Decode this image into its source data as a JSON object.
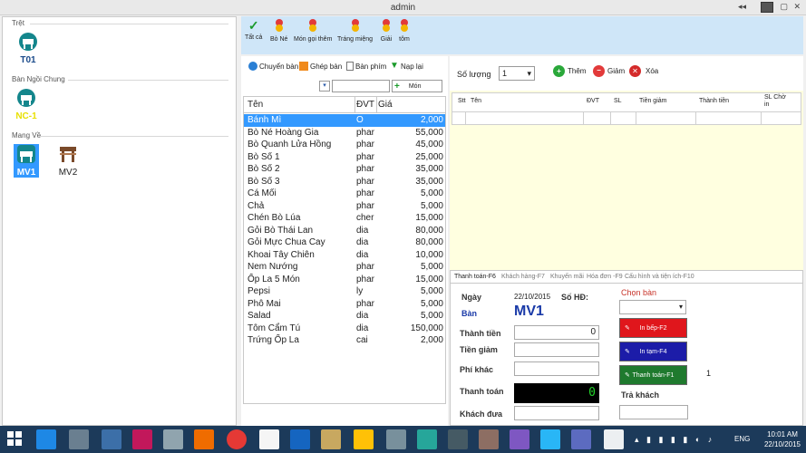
{
  "window": {
    "title": "admin"
  },
  "left_panel": {
    "sections": [
      {
        "label": "Trệt",
        "tables": [
          "T01"
        ]
      },
      {
        "label": "Bàn Ngồi Chung",
        "tables": [
          "NC-1"
        ]
      },
      {
        "label": "Mang Về",
        "tables": [
          "MV1",
          "MV2"
        ]
      }
    ]
  },
  "toolbar": {
    "items": [
      "Tất cả",
      "Bò Né",
      "Món gọi thêm",
      "Tráng miệng",
      "Giải",
      "tôm"
    ]
  },
  "menu_panel": {
    "actions": {
      "transfer": "Chuyển bàn",
      "merge": "Ghép bàn",
      "keys": "Bàn phím",
      "reload": "Nạp lại",
      "add_item": "Món"
    },
    "columns": {
      "name": "Tên",
      "unit": "ĐVT",
      "price": "Giá"
    },
    "products": [
      {
        "name": "Bánh Mì",
        "unit": "O",
        "price": "2,000"
      },
      {
        "name": "Bò Né Hoàng Gia",
        "unit": "phar",
        "price": "55,000"
      },
      {
        "name": "Bò Quanh Lửa Hồng",
        "unit": "phar",
        "price": "45,000"
      },
      {
        "name": "Bò Số 1",
        "unit": "phar",
        "price": "25,000"
      },
      {
        "name": "Bò Số 2",
        "unit": "phar",
        "price": "35,000"
      },
      {
        "name": "Bò Số 3",
        "unit": "phar",
        "price": "35,000"
      },
      {
        "name": "Cá Mối",
        "unit": "phar",
        "price": "5,000"
      },
      {
        "name": "Chả",
        "unit": "phar",
        "price": "5,000"
      },
      {
        "name": "Chén Bò Lúa",
        "unit": "cher",
        "price": "15,000"
      },
      {
        "name": "Gỏi Bò Thái Lan",
        "unit": "dia",
        "price": "80,000"
      },
      {
        "name": "Gỏi Mực Chua Cay",
        "unit": "dia",
        "price": "80,000"
      },
      {
        "name": "Khoai Tây Chiên",
        "unit": "dia",
        "price": "10,000"
      },
      {
        "name": "Nem Nướng",
        "unit": "phar",
        "price": "5,000"
      },
      {
        "name": "Ốp La 5 Món",
        "unit": "phar",
        "price": "15,000"
      },
      {
        "name": "Pepsi",
        "unit": "ly",
        "price": "5,000"
      },
      {
        "name": "Phô Mai",
        "unit": "phar",
        "price": "5,000"
      },
      {
        "name": "Salad",
        "unit": "dia",
        "price": "5,000"
      },
      {
        "name": "Tôm Cẩm Tú",
        "unit": "dia",
        "price": "150,000"
      },
      {
        "name": "Trứng Ốp La",
        "unit": "cai",
        "price": "2,000"
      }
    ]
  },
  "order_panel": {
    "qty_label": "Số lượng",
    "qty_value": "1",
    "add": "Thêm",
    "reduce": "Giảm",
    "delete": "Xóa",
    "columns": [
      "Stt",
      "Tên",
      "ĐVT",
      "SL",
      "Tiền giảm",
      "Thành tiền",
      "SL Chờ in"
    ]
  },
  "payment_panel": {
    "tabs": [
      "Thanh toán-F6",
      "Khách hàng-F7",
      "Khuyến mãi",
      "Hóa đơn -F9",
      "Cấu hình và tiện ích-F10"
    ],
    "date_label": "Ngày",
    "date_value": "22/10/2015",
    "invoice_label": "Số HĐ:",
    "table_label": "Bàn",
    "table_value": "MV1",
    "choose_table": "Chọn bàn",
    "total_label": "Thành tiền",
    "total_value": "0",
    "discount_label": "Tiền giảm",
    "other_label": "Phí khác",
    "pay_label": "Thanh toán",
    "pay_value": "0",
    "paid_label": "Khách đưa",
    "change_label": "Trả khách",
    "print_kitchen": "In bếp-F2",
    "print_temp": "In tạm-F4",
    "checkout": "Thanh toán-F1",
    "count": "1"
  },
  "taskbar": {
    "lang": "ENG",
    "time": "10:01 AM",
    "date": "22/10/2015"
  },
  "colors": {
    "toolbar_bg": "#cfe6f8",
    "selection": "#3399ff",
    "order_bg": "#ffffe0",
    "kitchen_btn": "#e0161c",
    "temp_btn": "#1c1ca8",
    "checkout_btn": "#1f7a2e",
    "pay_display": "#000000"
  }
}
